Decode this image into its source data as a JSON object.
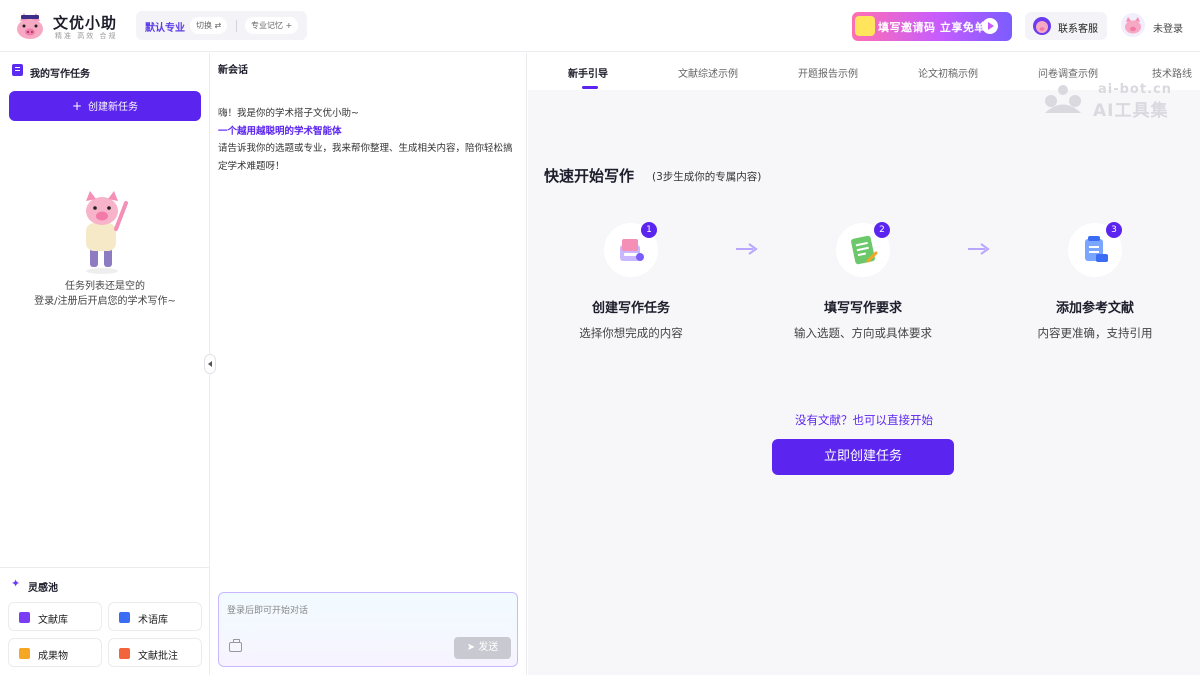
{
  "header": {
    "brand_title": "文优小助",
    "brand_subtitle": "精准 高效 合规",
    "major_label": "默认专业",
    "switch_label": "切换 ⇄",
    "memory_label": "专业记忆 +",
    "invite_banner": "填写邀请码 立享免单",
    "service_label": "联系客服",
    "login_label": "未登录"
  },
  "sidebar": {
    "title": "我的写作任务",
    "create_button": "创建新任务",
    "empty_line1": "任务列表还是空的",
    "empty_line2": "登录/注册后开启您的学术写作~",
    "inspiration_title": "灵感池",
    "tools": [
      {
        "label": "文献库",
        "color": "#7b3cf5"
      },
      {
        "label": "术语库",
        "color": "#3a6cf4"
      },
      {
        "label": "成果物",
        "color": "#f5a623"
      },
      {
        "label": "文献批注",
        "color": "#f2643c"
      }
    ]
  },
  "chat": {
    "title": "新会话",
    "greeting_line1": "嗨！我是你的学术搭子文优小助~",
    "greeting_highlight": "一个越用越聪明的学术智能体",
    "greeting_line3": "请告诉我你的选题或专业，我来帮你整理、生成相关内容，陪你轻松搞定学术难题呀！",
    "input_placeholder": "登录后即可开始对话",
    "send_label": "发送"
  },
  "main": {
    "tabs": [
      {
        "label": "新手引导",
        "active": true
      },
      {
        "label": "文献综述示例",
        "active": false
      },
      {
        "label": "开题报告示例",
        "active": false
      },
      {
        "label": "论文初稿示例",
        "active": false
      },
      {
        "label": "问卷调查示例",
        "active": false
      },
      {
        "label": "技术路线",
        "active": false
      }
    ],
    "watermark_top": "ai-bot.cn",
    "watermark_bottom": "AI工具集",
    "quick_title": "快速开始写作",
    "quick_subtitle": "(3步生成你的专属内容)",
    "steps": [
      {
        "num": "1",
        "title": "创建写作任务",
        "desc": "选择你想完成的内容"
      },
      {
        "num": "2",
        "title": "填写写作要求",
        "desc": "输入选题、方向或具体要求"
      },
      {
        "num": "3",
        "title": "添加参考文献",
        "desc": "内容更准确，支持引用"
      }
    ],
    "no_ref_text": "没有文献？也可以直接开始",
    "start_button": "立即创建任务",
    "accent_color": "#5b24ef"
  }
}
